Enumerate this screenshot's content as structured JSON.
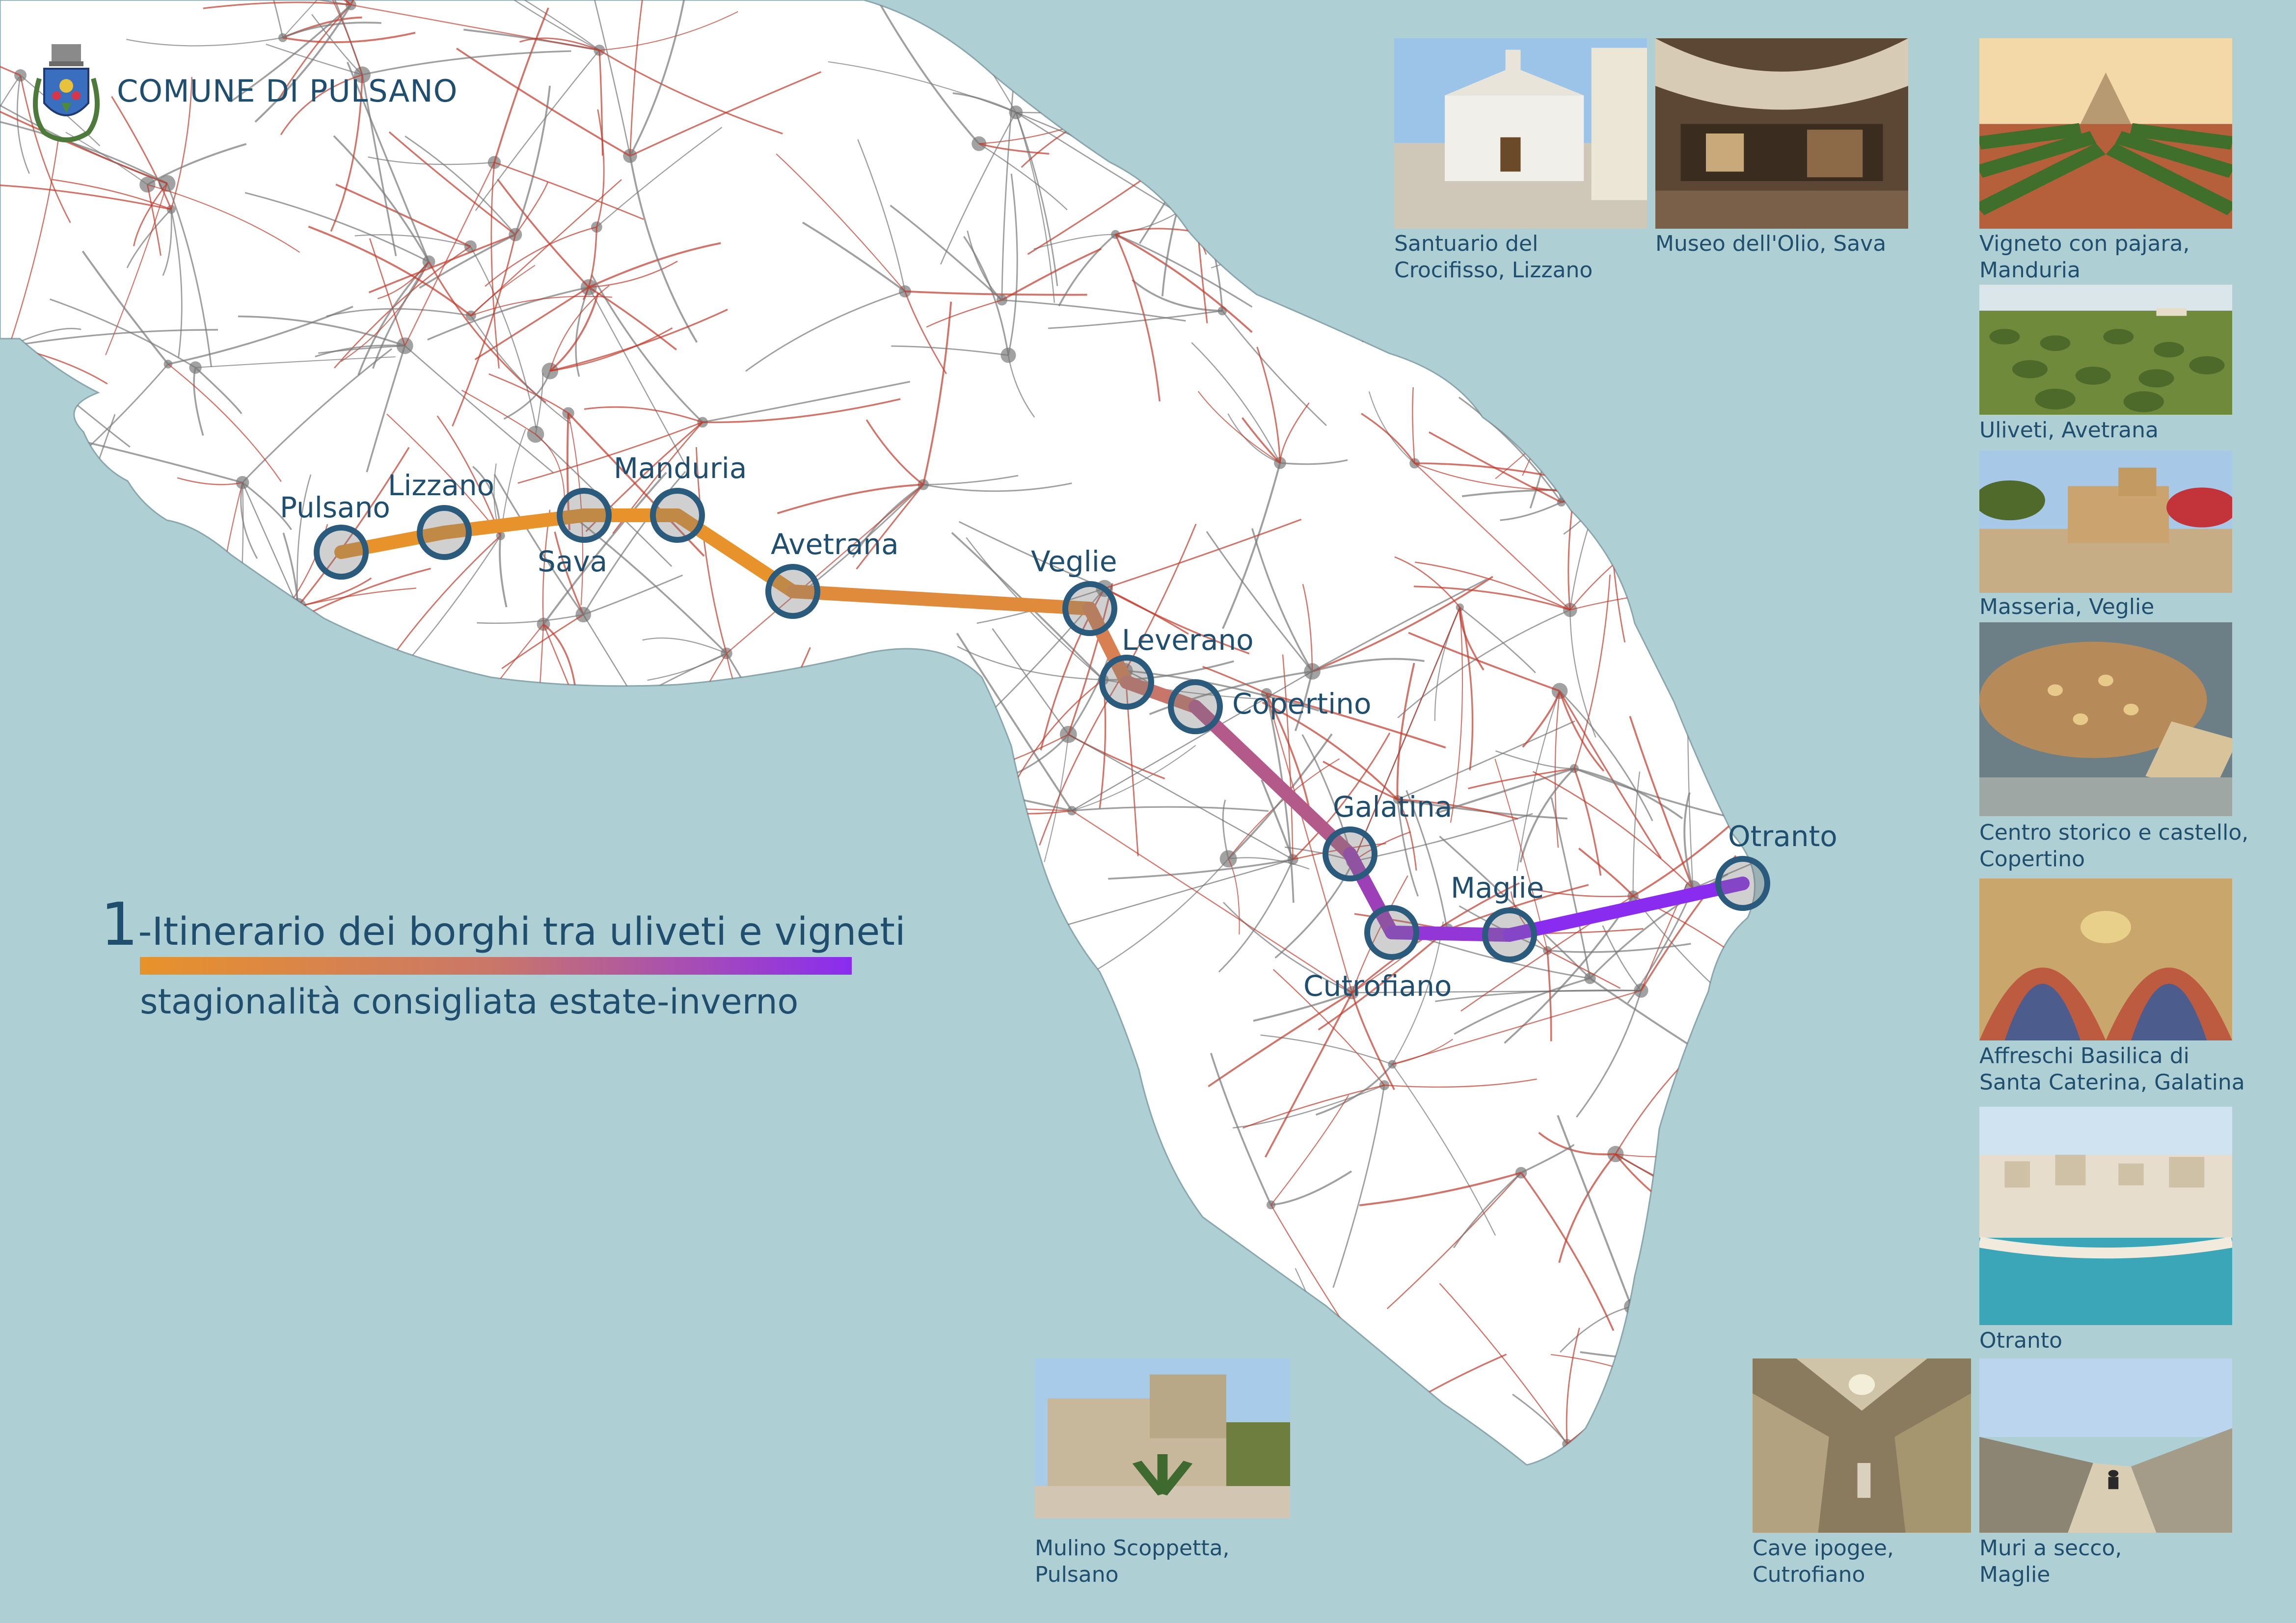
{
  "header": {
    "title": "COMUNE DI PULSANO"
  },
  "legend": {
    "number": "1",
    "title": "-Itinerario dei borghi tra uliveti e vigneti",
    "season": "stagionalità consigliata estate-inverno",
    "gradient_colors": [
      "#e8922b",
      "#c9766a",
      "#8a2cf0"
    ]
  },
  "colors": {
    "sea": "#aecfd3",
    "land": "#ffffff",
    "marker": "#2a5a7c",
    "route_orange": "#e8922b",
    "route_purple": "#8a2cf0"
  },
  "towns": [
    {
      "name": "Pulsano"
    },
    {
      "name": "Lizzano"
    },
    {
      "name": "Sava"
    },
    {
      "name": "Manduria"
    },
    {
      "name": "Avetrana"
    },
    {
      "name": "Veglie"
    },
    {
      "name": "Leverano"
    },
    {
      "name": "Copertino"
    },
    {
      "name": "Galatina"
    },
    {
      "name": "Cutrofiano"
    },
    {
      "name": "Maglie"
    },
    {
      "name": "Otranto"
    }
  ],
  "photos": [
    {
      "caption": [
        "Santuario del",
        "Crocifisso, Lizzano"
      ],
      "scene": "chapel"
    },
    {
      "caption": [
        "Museo dell'Olio, Sava"
      ],
      "scene": "museum"
    },
    {
      "caption": [
        "Vigneto con pajara,",
        "Manduria"
      ],
      "scene": "vineyard"
    },
    {
      "caption": [
        "Uliveti, Avetrana"
      ],
      "scene": "olives"
    },
    {
      "caption": [
        "Masseria, Veglie"
      ],
      "scene": "masseria"
    },
    {
      "caption": [
        "Centro storico e castello,",
        "Copertino"
      ],
      "scene": "aerial"
    },
    {
      "caption": [
        "Affreschi Basilica di",
        "Santa Caterina, Galatina"
      ],
      "scene": "frescoes"
    },
    {
      "caption": [
        "Otranto"
      ],
      "scene": "coast"
    },
    {
      "caption": [
        "Mulino Scoppetta,",
        "Pulsano"
      ],
      "scene": "mill"
    },
    {
      "caption": [
        "Cave ipogee,",
        "Cutrofiano"
      ],
      "scene": "cave"
    },
    {
      "caption": [
        "Muri a secco,",
        "Maglie"
      ],
      "scene": "walls"
    }
  ]
}
